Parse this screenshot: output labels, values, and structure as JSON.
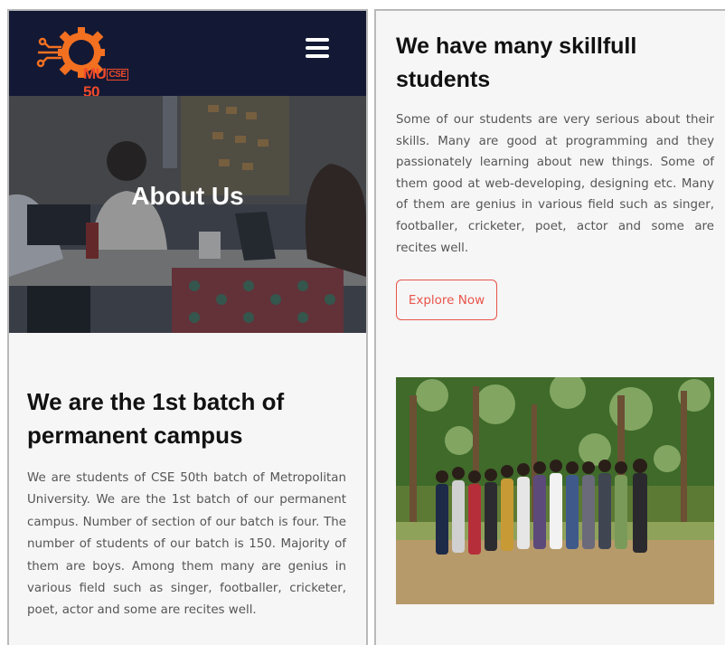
{
  "left_panel": {
    "logo": {
      "text_a": "MU",
      "text_box": "CSE",
      "text_b": "50"
    },
    "hero": {
      "title": "About Us"
    },
    "section": {
      "heading": "We are the 1st batch of permanent campus",
      "paragraph": "We are students of CSE 50th batch of Metropolitan University. We are the 1st batch of our permanent campus. Number of section of our batch is four. The number of students of our batch is 150. Majority of them are boys. Among them many are genius in various field such as singer, footballer, cricketer, poet, actor and some are recites well."
    }
  },
  "right_panel": {
    "heading": "We have many skillfull students",
    "paragraph": "Some of our students are very serious about their skills. Many are good at programming and they passionately learning about new things. Some of them good at web-developing, designing etc. Many of them are genius in various field such as singer, footballer, cricketer, poet, actor and some are recites well.",
    "button_label": "Explore Now"
  },
  "colors": {
    "navbar": "#131935",
    "logo": "#f04a2a",
    "button_accent": "#e8544b",
    "panel_bg": "#f6f6f6"
  },
  "icons": {
    "logo": "gear-circuit-logo",
    "menu": "hamburger-menu-icon"
  }
}
